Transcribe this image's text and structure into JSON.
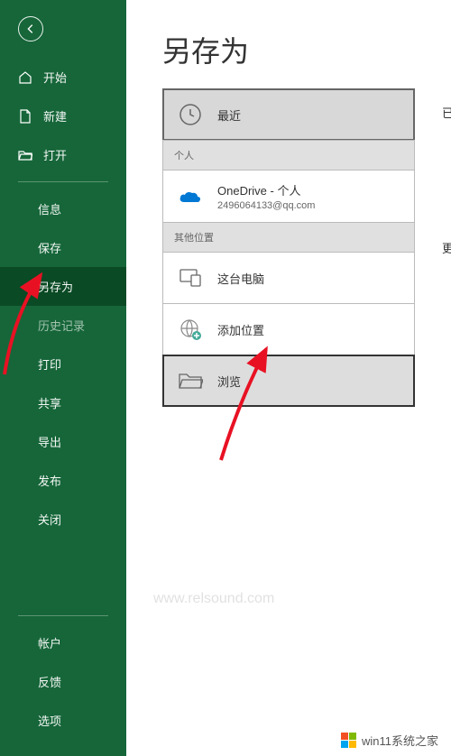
{
  "sidebar": {
    "items": [
      {
        "label": "开始",
        "icon": "home"
      },
      {
        "label": "新建",
        "icon": "document"
      },
      {
        "label": "打开",
        "icon": "folder-open"
      }
    ],
    "indentItems": [
      {
        "label": "信息"
      },
      {
        "label": "保存"
      },
      {
        "label": "另存为",
        "selected": true
      },
      {
        "label": "历史记录"
      },
      {
        "label": "打印"
      },
      {
        "label": "共享"
      },
      {
        "label": "导出"
      },
      {
        "label": "发布"
      },
      {
        "label": "关闭"
      }
    ],
    "bottomItems": [
      {
        "label": "帐户"
      },
      {
        "label": "反馈"
      },
      {
        "label": "选项"
      }
    ]
  },
  "main": {
    "title": "另存为",
    "sections": {
      "personal": "个人",
      "other": "其他位置"
    },
    "locations": {
      "recent": "最近",
      "onedrive": {
        "title": "OneDrive - 个人",
        "subtitle": "2496064133@qq.com"
      },
      "thisPC": "这台电脑",
      "addPlace": "添加位置",
      "browse": "浏览"
    }
  },
  "watermark": "www.relsound.com",
  "bottomLogo": "win11系统之家",
  "rightEdge": {
    "line1": "已",
    "line2": "更"
  }
}
